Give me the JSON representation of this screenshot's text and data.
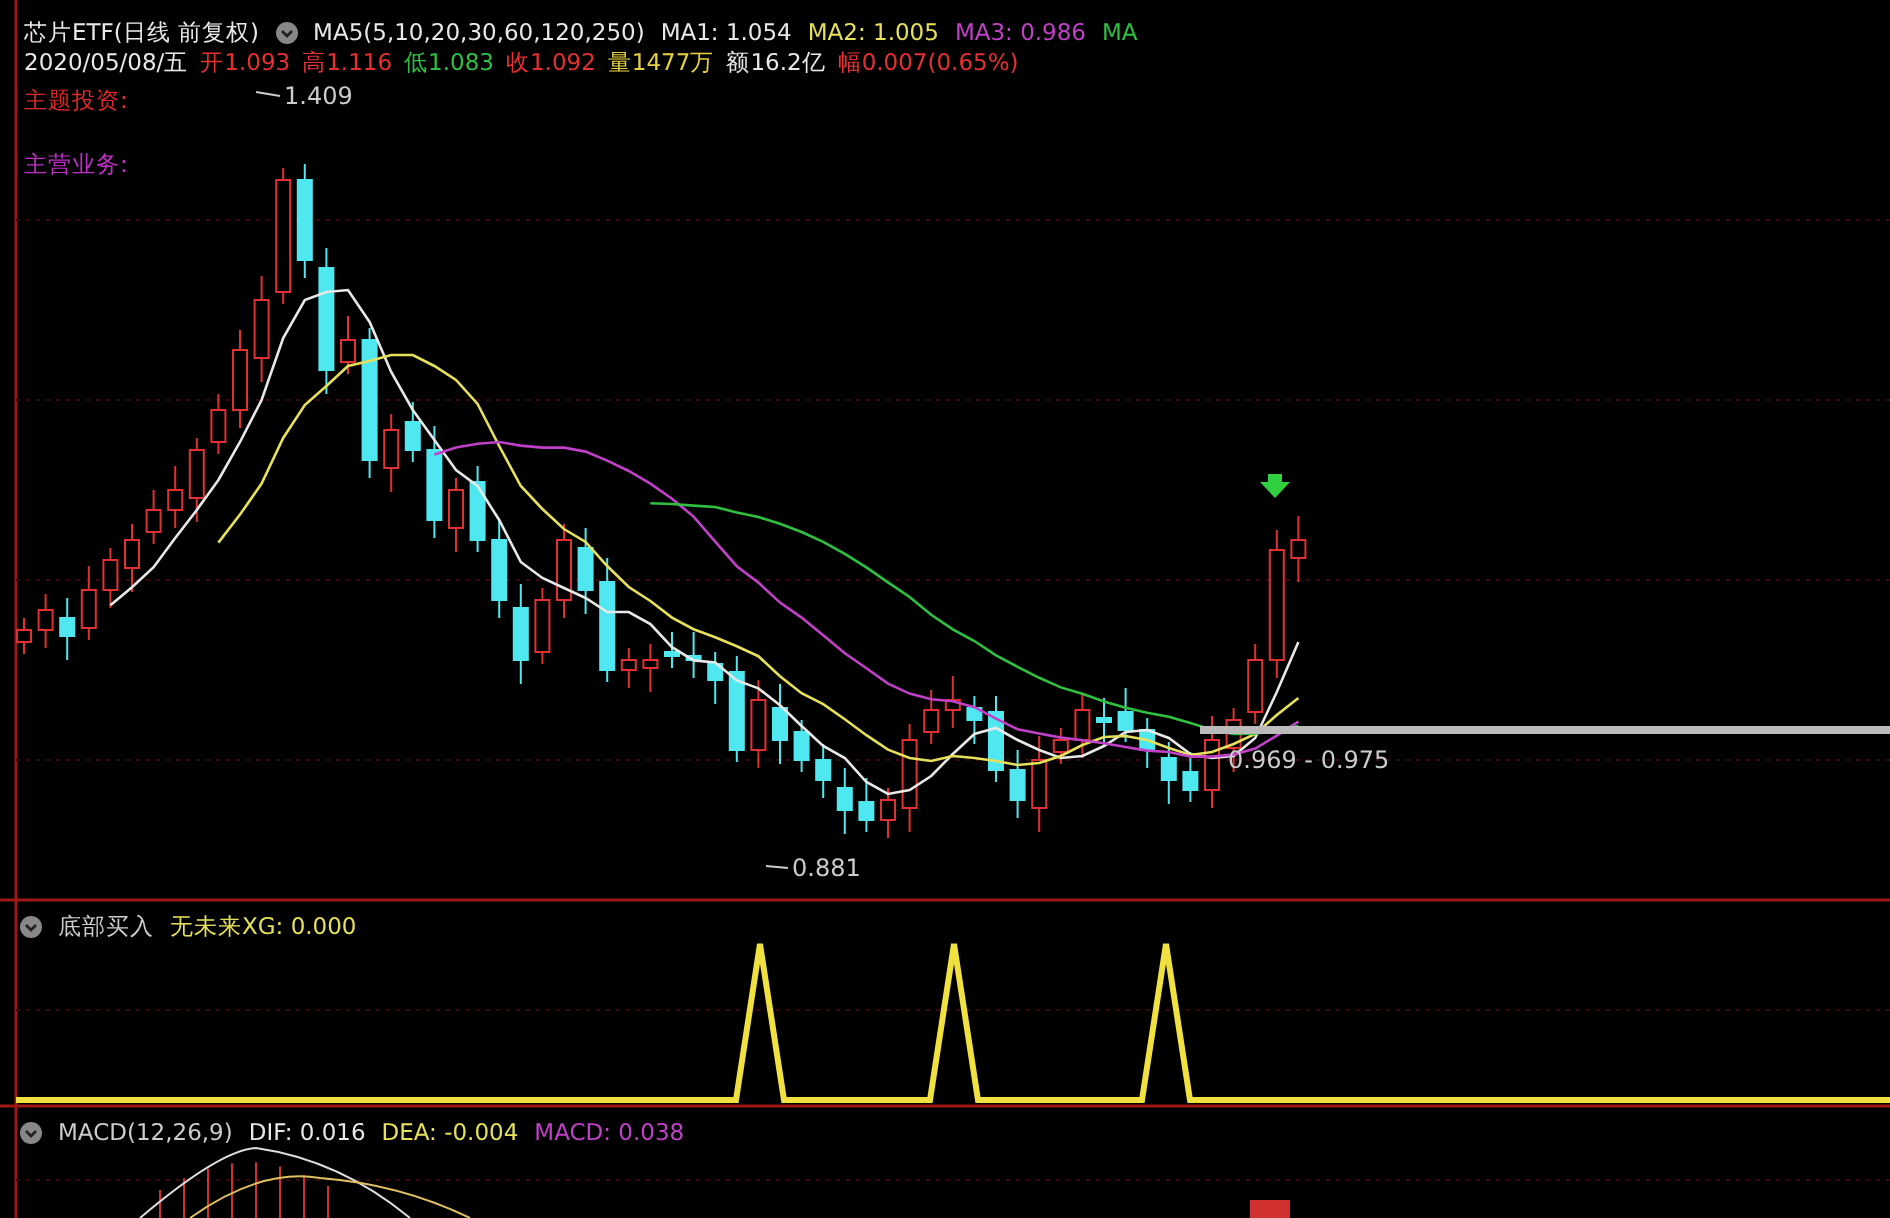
{
  "header": {
    "title": "芯片ETF(日线 前复权)",
    "indicator": "MA5(5,10,20,30,60,120,250)",
    "ma_values": [
      {
        "text": "MA1: 1.054",
        "color": "#e8e8e8"
      },
      {
        "text": "MA2: 1.005",
        "color": "#e6e05a"
      },
      {
        "text": "MA3: 0.986",
        "color": "#c040c8"
      },
      {
        "text": "MA",
        "color": "#30c040"
      }
    ]
  },
  "quote": {
    "date": "2020/05/08/五",
    "fields": [
      {
        "text": "开1.093",
        "color": "#e83030"
      },
      {
        "text": "高1.116",
        "color": "#e83030"
      },
      {
        "text": "低1.083",
        "color": "#30c040"
      },
      {
        "text": "收1.092",
        "color": "#e83030"
      },
      {
        "text": "量1477万",
        "color": "#e6d040"
      },
      {
        "text": "额16.2亿",
        "color": "#e8e8e8"
      },
      {
        "text": "幅0.007(0.65%)",
        "color": "#e83030"
      }
    ]
  },
  "side_labels": [
    {
      "text": "主题投资:",
      "color": "#e02828"
    },
    {
      "text": "主营业务:",
      "color": "#c030c8"
    }
  ],
  "price_labels": {
    "high": "1.409",
    "low": "0.881",
    "current": "0.969 - 0.975"
  },
  "xg_panel": {
    "title": "底部买入",
    "reading": "无未来XG: 0.000"
  },
  "macd_panel": {
    "title": "MACD(12,26,9)",
    "readings": [
      {
        "text": "DIF: 0.016",
        "color": "#e8e8e8"
      },
      {
        "text": "DEA: -0.004",
        "color": "#e6e05a"
      },
      {
        "text": "MACD: 0.038",
        "color": "#c040c8"
      }
    ]
  }
}
